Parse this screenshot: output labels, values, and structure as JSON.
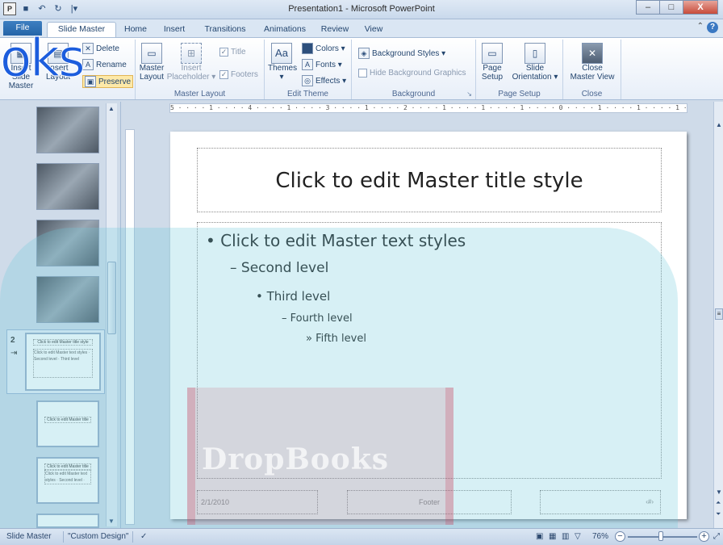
{
  "window": {
    "title": "Presentation1  -  Microsoft PowerPoint",
    "minimize": "–",
    "maximize": "□",
    "close": "X"
  },
  "qat": {
    "app": "P",
    "save": "■",
    "undo": "↶",
    "redo": "↻",
    "customize": "|▾"
  },
  "tabs": {
    "file": "File",
    "items": [
      "Slide Master",
      "Home",
      "Insert",
      "Transitions",
      "Animations",
      "Review",
      "View"
    ]
  },
  "ribbon": {
    "edit_master": {
      "delete": "Delete",
      "rename": "Rename",
      "preserve": "Preserve",
      "insert_layout_1": "Insert",
      "insert_layout_2": "Layout",
      "insert_slide_master_1": "Insert Slide",
      "insert_slide_master_2": "Master"
    },
    "master_layout": {
      "label": "Master Layout",
      "master_layout_1": "Master",
      "master_layout_2": "Layout",
      "insert_placeholder_1": "Insert",
      "insert_placeholder_2": "Placeholder ▾",
      "title": "Title",
      "footers": "Footers"
    },
    "edit_theme": {
      "label": "Edit Theme",
      "themes": "Themes",
      "themes_arrow": "▾",
      "colors": "Colors ▾",
      "fonts": "Fonts ▾",
      "effects": "Effects ▾"
    },
    "background": {
      "label": "Background",
      "styles": "Background Styles ▾",
      "hide": "Hide Background Graphics"
    },
    "page_setup": {
      "label": "Page Setup",
      "setup_1": "Page",
      "setup_2": "Setup",
      "orientation_1": "Slide",
      "orientation_2": "Orientation ▾"
    },
    "close": {
      "label": "Close",
      "btn_1": "Close",
      "btn_2": "Master View"
    }
  },
  "watermark": {
    "ribbon_text": "oks",
    "overlay_text": "DropBooks"
  },
  "hruler": "5 · · · · 1 · · · · 4 · · · · 1 · · · · 3 · · · · 1 · · · · 2 · · · · 1 · · · · 1 · · · · 1 · · · · 0 · · · · 1 · · · · 1 · · · · 1 · · · · 2 · · · · 1 · · · · 3 · · · · 1 · · · · 4 · · · · 1 · · · · 5",
  "thumbs": {
    "selected_number": "2",
    "mini_title": "Click to edit Master title style",
    "mini_body": "Click to edit Master text styles · Second level · Third level"
  },
  "slide": {
    "title": "Click to edit Master title style",
    "levels": [
      "•  Click to edit Master text styles",
      "– Second level",
      "•  Third level",
      "–  Fourth level",
      "»  Fifth level"
    ],
    "date": "2/1/2010",
    "footer": "Footer",
    "slide_number": "‹#›"
  },
  "statusbar": {
    "view": "Slide Master",
    "theme": "\"Custom Design\"",
    "zoom": "76%",
    "zoom_out": "−",
    "zoom_in": "+",
    "zoom_level_fraction": 0.5
  }
}
